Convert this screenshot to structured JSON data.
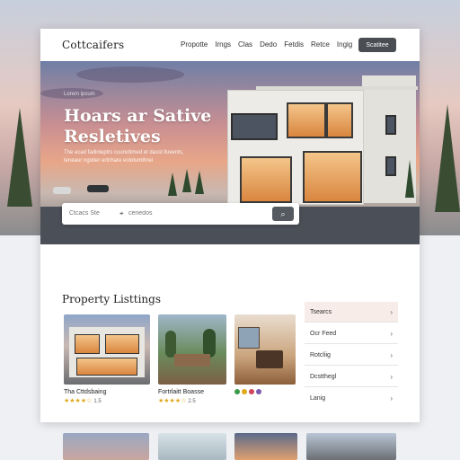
{
  "brand": "Cottcaifers",
  "nav": {
    "links": [
      "Propotte",
      "Irngs",
      "Clas",
      "Dedo",
      "Fetdis",
      "Retce",
      "Ingig"
    ],
    "cta": "Scatitee"
  },
  "hero": {
    "kicker": "Lorem ipsum",
    "title_line1": "Hoars ar Sative",
    "title_line2": "Resletives",
    "subtitle": "The ecad fadinleptrs cuunotimed et dasst lluvents, teneaur ngotier ertnhare eolotumthrei",
    "search": {
      "field1_placeholder": "Ctcacs Ste",
      "field2_placeholder": "cenedos",
      "button_icon": "search-icon"
    }
  },
  "listings": {
    "title": "Property Listtings",
    "cards": [
      {
        "title": "Tha Cttdsbaing",
        "rating_stars": "★★★★☆",
        "rating_value": "1.5"
      },
      {
        "title": "Fortrlaitt Boasse",
        "rating_stars": "★★★★☆",
        "rating_value": "2.5"
      },
      {
        "title": "",
        "rating_stars": "",
        "rating_value": ""
      }
    ]
  },
  "filters": [
    {
      "label": "Tsearcs",
      "active": true
    },
    {
      "label": "Ocr Feed",
      "active": false
    },
    {
      "label": "Rotcliig",
      "active": false
    },
    {
      "label": "Dcstthegl",
      "active": false
    },
    {
      "label": "Lanig",
      "active": false
    }
  ],
  "colors": {
    "accent_dark": "#4a4d52",
    "star": "#e0a91c",
    "active_filter_bg": "#f7ece7"
  }
}
